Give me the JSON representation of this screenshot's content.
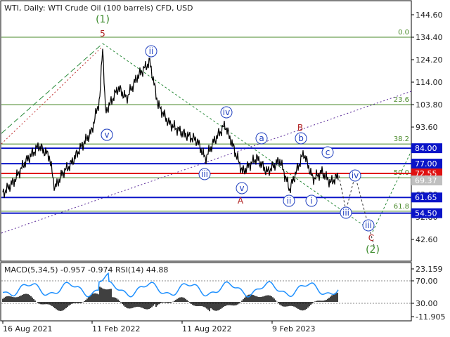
{
  "header": {
    "title": "WTI, Daily:  WTI Crude Oil (100 barrels) CFD, USD"
  },
  "price_axis": {
    "ticks": [
      "144.60",
      "134.40",
      "124.20",
      "114.00",
      "103.80",
      "93.60",
      "83.40",
      "73.20",
      "63.00",
      "52.80",
      "42.60"
    ]
  },
  "price_tags": [
    {
      "label": "84.00",
      "value": 84.0,
      "color": "#0a14c8"
    },
    {
      "label": "77.00",
      "value": 77.0,
      "color": "#0a14c8"
    },
    {
      "label": "72.55",
      "value": 72.55,
      "color": "#e01010"
    },
    {
      "label": "69.37",
      "value": 69.37,
      "color": "#bfbfbf"
    },
    {
      "label": "61.65",
      "value": 61.65,
      "color": "#0a14c8"
    },
    {
      "label": "54.50",
      "value": 54.5,
      "color": "#0a14c8"
    }
  ],
  "fib_levels": [
    {
      "label": "0.0",
      "value": 134.4
    },
    {
      "label": "23.6",
      "value": 103.8
    },
    {
      "label": "38.2",
      "value": 85.9
    },
    {
      "label": "50.0",
      "value": 70.6
    },
    {
      "label": "61.8",
      "value": 55.4
    }
  ],
  "wave_labels": {
    "blue": [
      "i",
      "ii",
      "iii",
      "iv",
      "v",
      "a",
      "b",
      "c",
      "ii",
      "i",
      "iii",
      "iv",
      "iii",
      "v"
    ],
    "red": [
      "5",
      "A",
      "B",
      "C"
    ],
    "green": [
      "(1)",
      "(2)"
    ]
  },
  "indicator": {
    "title": "MACD(5,34,5) -0.957 -0.974 RSI(14) 44.88",
    "ticks": [
      "23.159",
      "70.00",
      "30.00",
      "-11.905"
    ]
  },
  "time_axis": {
    "labels": [
      "16 Aug 2021",
      "11 Feb 2022",
      "11 Aug 2022",
      "9 Feb 2023"
    ]
  },
  "colors": {
    "support": "#0a14c8",
    "resistance_current": "#e01010",
    "fib": "#4a8a2a",
    "rsi": "#1e90ff",
    "macd": "#000000"
  }
}
